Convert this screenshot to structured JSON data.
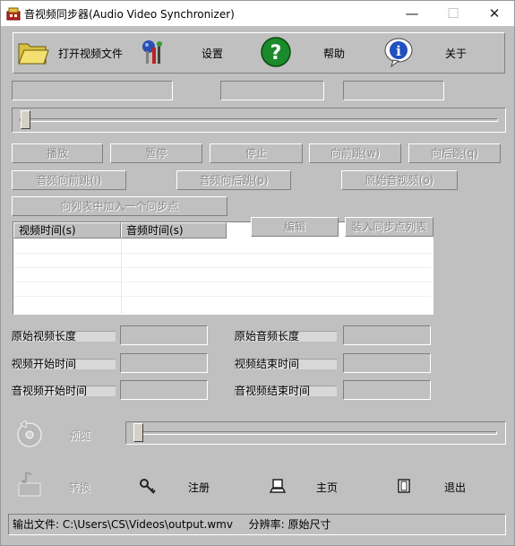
{
  "window": {
    "title": "音视频同步器(Audio Video Synchronizer)",
    "minimize_glyph": "—",
    "maximize_glyph": "☐",
    "close_glyph": "✕"
  },
  "toolbar": {
    "open_label": "打开视频文件",
    "settings_label": "设置",
    "help_label": "帮助",
    "about_label": "关于"
  },
  "playback": {
    "play": "播放",
    "pause": "暂停",
    "stop": "停止",
    "jump_forward": "向前跳(w)",
    "jump_back": "向后跳(q)",
    "audio_forward": "音频向前跳(i)",
    "audio_back": "音频向后跳(p)",
    "original_av": "原始音视频(o)",
    "add_sync_point": "向列表中加入一个同步点",
    "seek_position": 0
  },
  "sync_list": {
    "columns": [
      "视频时间(s)",
      "音频时间(s)"
    ],
    "edit_button": "编辑",
    "load_button": "装入同步点列表",
    "rows": []
  },
  "info": {
    "orig_video_len": "原始视频长度",
    "orig_audio_len": "原始音频长度",
    "video_start": "视频开始时间",
    "video_end": "视频结束时间",
    "av_start": "音视频开始时间",
    "av_end": "音视频结束时间"
  },
  "preview": {
    "label": "预览",
    "position": 0
  },
  "bottom": {
    "convert": "转换",
    "register": "注册",
    "home": "主页",
    "exit": "退出"
  },
  "status": {
    "output_label": "输出文件:",
    "output_path": "C:\\Users\\CS\\Videos\\output.wmv",
    "resolution_label": "分辨率:",
    "resolution_value": "原始尺寸"
  }
}
